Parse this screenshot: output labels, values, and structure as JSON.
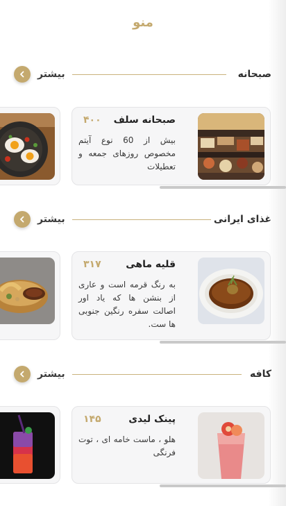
{
  "header": {
    "title": "منو"
  },
  "sections": [
    {
      "title": "صبحانه",
      "more_label": "بیشتر",
      "item": {
        "name": "صبحانه سلف",
        "price": "۴۰۰",
        "description": "بیش از 60 نوع آیتم مخصوص روزهای جمعه و تعطیلات"
      }
    },
    {
      "title": "غذای ایرانی",
      "more_label": "بیشتر",
      "item": {
        "name": "قلیه ماهی",
        "price": "۳۱۷",
        "description": "به رنگ قرمه است و عاری از بنشن ها که یاد اور اصالت سفره رنگین جنوبی ها ست."
      }
    },
    {
      "title": "کافه",
      "more_label": "بیشتر",
      "item": {
        "name": "پینک لیدی",
        "price": "۱۴۵",
        "description": "هلو ، ماست خامه ای ، توت فرنگی"
      }
    }
  ],
  "colors": {
    "accent": "#c4a96e",
    "card_bg": "#f6f6f7",
    "scrollbar": "#c9c9c9"
  },
  "icons": {
    "more": "chevron-left-icon"
  }
}
